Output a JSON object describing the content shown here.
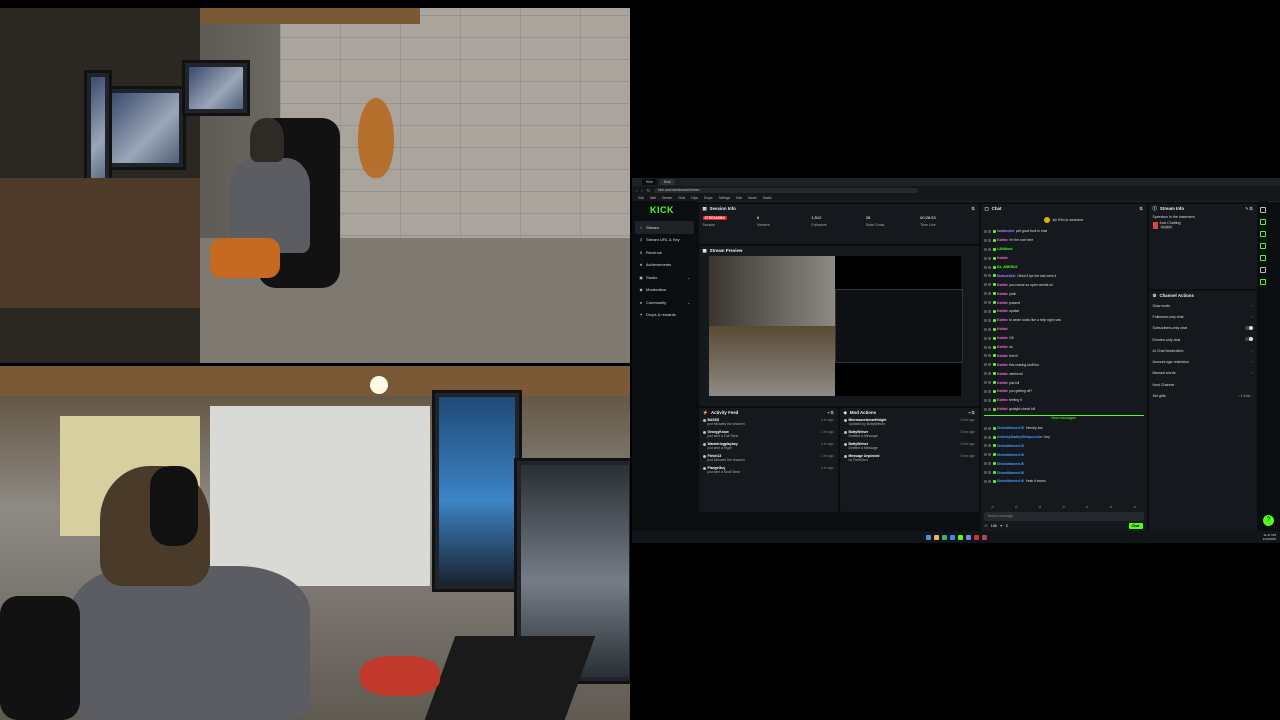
{
  "cameras": {
    "top": "webcam-top-basement-desk",
    "bottom": "webcam-bottom-over-shoulder"
  },
  "browser": {
    "tabs": [
      "Kick",
      "Kick"
    ],
    "url": "kick.com/dashboard/stream",
    "bookmarks": [
      "Kick",
      "Mail",
      "Stream",
      "Chat",
      "Clips",
      "Drops",
      "Settings",
      "Kick",
      "Home",
      "Studio"
    ]
  },
  "sidebar": {
    "logo": "KICK",
    "items": [
      {
        "label": "Stream",
        "icon": "home-icon"
      },
      {
        "label": "Stream URL & Key",
        "icon": "key-icon"
      },
      {
        "label": "Revenue",
        "icon": "dollar-icon"
      },
      {
        "label": "Achievements",
        "icon": "trophy-icon"
      },
      {
        "label": "Studio",
        "icon": "studio-icon"
      },
      {
        "label": "Moderation",
        "icon": "shield-icon"
      },
      {
        "label": "Community",
        "icon": "community-icon"
      },
      {
        "label": "Drops & rewards",
        "icon": "gift-icon"
      }
    ]
  },
  "session": {
    "title": "Session Info",
    "live": "STREAMING",
    "stats": [
      {
        "value": "",
        "label": "Session"
      },
      {
        "value": "8",
        "label": "Viewers"
      },
      {
        "value": "1,512",
        "label": "Followers"
      },
      {
        "value": "28",
        "label": "Subs Goals"
      },
      {
        "value": "00:28:53",
        "label": "Time Live"
      }
    ]
  },
  "preview": {
    "title": "Stream Preview"
  },
  "activity": {
    "title": "Activity Feed",
    "items": [
      {
        "user": "BASSS",
        "desc": "just followed the channel",
        "time": "1 hr ago"
      },
      {
        "user": "GeorgyKnow",
        "desc": "just sent a Full Send",
        "time": "1 hr ago"
      },
      {
        "user": "Wanderingplayboy",
        "desc": "just sent a Hype",
        "time": "1 hr ago"
      },
      {
        "user": "Fletch13",
        "desc": "just followed the channel",
        "time": "1 hr ago"
      },
      {
        "user": "PlangeGuy",
        "desc": "just sent a Skull Send",
        "time": "1 hr ago"
      }
    ]
  },
  "mod": {
    "title": "Mod Actions",
    "items": [
      {
        "user": "MicrowaveIsmartVoight",
        "desc": "Updated by BottyWeiser",
        "time": "3 hrs ago"
      },
      {
        "user": "BottyWeiser",
        "desc": "Deleted a Message",
        "time": "3 hrs ago"
      },
      {
        "user": "BottyWeiser",
        "desc": "Deleted a Message",
        "time": "3 hrs ago"
      },
      {
        "user": "Message Unpinned",
        "desc": "by FlareGuru",
        "time": "4 hrs ago"
      }
    ]
  },
  "chat": {
    "title": "Chat",
    "pinned": "lyk Rfm is welcome",
    "messages": [
      {
        "user": "lootbucket",
        "text": "yall good fuck in chat",
        "color": "#b07cff"
      },
      {
        "user": "Kolteb",
        "text": "i'm the one here",
        "color": "#ff6bd6"
      },
      {
        "user": "LANdlord",
        "text": "",
        "color": "#53fc18"
      },
      {
        "user": "Kolteb",
        "text": "",
        "color": "#ff6bd6"
      },
      {
        "user": "Ka_ANKNO2",
        "text": "",
        "color": "#53fc18"
      },
      {
        "user": "Nutbucklist",
        "text": "i liked it lye the last ones it",
        "color": "#b07cff"
      },
      {
        "user": "Kolteb",
        "text": "you house so open weirds lol",
        "color": "#ff6bd6"
      },
      {
        "user": "Kolteb",
        "text": "yeah",
        "color": "#ff6bd6"
      },
      {
        "user": "Kolteb",
        "text": "passed",
        "color": "#ff6bd6"
      },
      {
        "user": "Kolteb",
        "text": "update",
        "color": "#ff6bd6"
      },
      {
        "user": "Kolteb",
        "text": "to wrote looks like a help right now",
        "color": "#ff6bd6"
      },
      {
        "user": "Kolteb",
        "text": "",
        "color": "#ff6bd6"
      },
      {
        "user": "Kolteb",
        "text": "OK",
        "color": "#ff6bd6"
      },
      {
        "user": "Kolteb",
        "text": "ok",
        "color": "#ff6bd6"
      },
      {
        "user": "Kolteb",
        "text": "first ill",
        "color": "#ff6bd6"
      },
      {
        "user": "Kolteb",
        "text": "this making stuff too",
        "color": "#ff6bd6"
      },
      {
        "user": "Kolteb",
        "text": "weekend",
        "color": "#ff6bd6"
      },
      {
        "user": "Kolteb",
        "text": "just kill",
        "color": "#ff6bd6"
      },
      {
        "user": "Kolteb",
        "text": "you getting off?",
        "color": "#ff6bd6"
      },
      {
        "user": "Kolteb",
        "text": "feeling it",
        "color": "#ff6bd6"
      },
      {
        "user": "Kolteb",
        "text": "gotright check kill",
        "color": "#ff6bd6"
      }
    ],
    "new_messages": "New messages",
    "messages_after": [
      {
        "user": "ShimaMannerUK",
        "text": "friendly ass",
        "color": "#3a9fff"
      },
      {
        "user": "AnthonyDaddyStickpounder",
        "text": "hey",
        "color": "#3a9fff"
      },
      {
        "user": "ShimaMannerUK",
        "text": "",
        "color": "#3a9fff"
      },
      {
        "user": "ShimaMannerUK",
        "text": "",
        "color": "#3a9fff"
      },
      {
        "user": "ShimaMannerUK",
        "text": "",
        "color": "#3a9fff"
      },
      {
        "user": "ShimaMannerUK",
        "text": "",
        "color": "#3a9fff"
      },
      {
        "user": "ShimaMannerUK",
        "text": "Yeah it works",
        "color": "#3a9fff"
      }
    ],
    "input_placeholder": "Send a message",
    "footer_count": "156",
    "footer_count2": "0",
    "chat_button": "Chat"
  },
  "stream_info": {
    "title": "Stream Info",
    "stream_title": "Speedrun in the basement",
    "category": "Just Chatting",
    "tag": "English"
  },
  "channel_actions": {
    "title": "Channel Actions",
    "items": [
      {
        "label": "Slow mode",
        "control": "›"
      },
      {
        "label": "Followers-only chat",
        "control": "›"
      },
      {
        "label": "Subscribers-only chat",
        "control": "toggle"
      },
      {
        "label": "Emotes-only chat",
        "control": "toggle"
      },
      {
        "label": "AI Chat Moderation",
        "control": "›"
      },
      {
        "label": "Account age restriction",
        "control": "›"
      },
      {
        "label": "Banned words",
        "control": "›"
      },
      {
        "label": "Host Channel",
        "control": ""
      },
      {
        "label": "Set gifts",
        "control": "› 1 Kick ›"
      }
    ]
  },
  "clock": {
    "time": "11:47 PM",
    "date": "1/20/2025"
  },
  "colors": {
    "accent": "#53fc18",
    "live": "#e22222",
    "panel": "#15181c",
    "bg": "#0b0e11"
  }
}
